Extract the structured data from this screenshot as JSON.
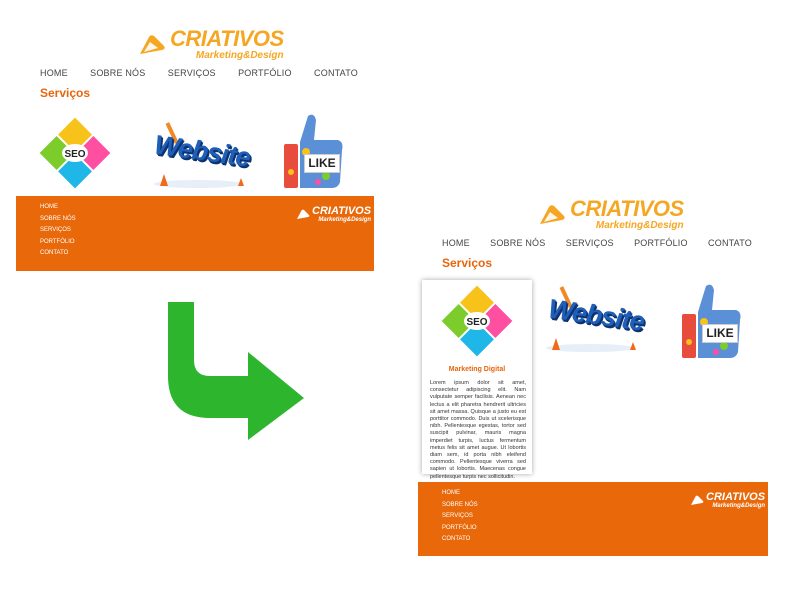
{
  "brand": {
    "name": "CRIATIVOS",
    "tagline": "Marketing&Design"
  },
  "nav": {
    "items": [
      "HOME",
      "SOBRE NÓS",
      "SERVIÇOS",
      "PORTFÓLIO",
      "CONTATO"
    ]
  },
  "section": {
    "title": "Serviços"
  },
  "images": {
    "seo_label": "SEO",
    "website_word": "Website",
    "like_word": "LIKE"
  },
  "footer": {
    "links": [
      "HOME",
      "SOBRE NÓS",
      "SERVIÇOS",
      "PORTFÓLIO",
      "CONTATO"
    ]
  },
  "card": {
    "title": "Marketing Digital",
    "text": "Lorem ipsum dolor sit amet, consectetur adipiscing elit. Nam vulputate semper facilisis. Aenean nec lectus a elit pharetra hendrerit ultricies sit amet massa. Quisque a justo eu est porttitor commodo. Duis ut scelerisque nibh. Pellentesque egestas, tortor sed suscipit pulvinar, mauris magna imperdiet turpis, luctus fermentum metus felis sit amet augue. Ut lobortis diam sem, id porta nibh eleifend commodo. Pellentesque viverra sed sapien ut lobortis. Maecenas congue pellentesque turpis nec sollicitudin."
  },
  "colors": {
    "brand_orange": "#e8680a",
    "logo_yellow": "#f5a623",
    "arrow_green": "#2db52d",
    "title_orange": "#e8650c"
  },
  "icons": [
    "logo-icon",
    "seo-diagram-icon",
    "website-3d-icon",
    "like-thumb-icon",
    "transition-arrow-icon"
  ]
}
